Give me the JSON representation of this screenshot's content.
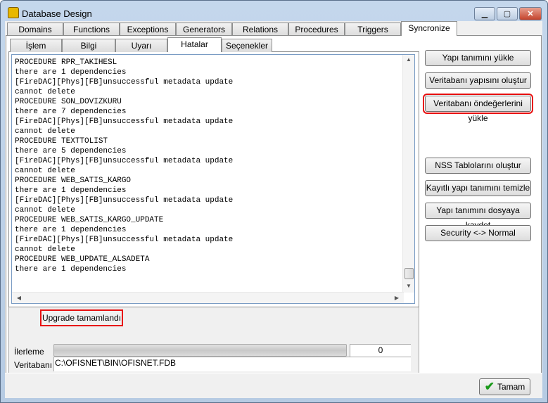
{
  "window": {
    "title": "Database Design",
    "controls": {
      "minimize": "▁",
      "maximize": "▢",
      "close": "✕"
    }
  },
  "main_tabs": [
    "Domains",
    "Functions",
    "Exceptions",
    "Generators",
    "Relations",
    "Procedures",
    "Triggers",
    "Syncronize"
  ],
  "main_tab_selected": "Syncronize",
  "sub_tabs": [
    "İşlem",
    "Bilgi",
    "Uyarı",
    "Hatalar",
    "Seçenekler"
  ],
  "sub_tab_selected": "Hatalar",
  "log_lines": [
    "PROCEDURE RPR_TAKIHESL",
    "there are 1 dependencies",
    "[FireDAC][Phys][FB]unsuccessful metadata update",
    "cannot delete",
    "PROCEDURE SON_DOVIZKURU",
    "there are 7 dependencies",
    "[FireDAC][Phys][FB]unsuccessful metadata update",
    "cannot delete",
    "PROCEDURE TEXTTOLIST",
    "there are 5 dependencies",
    "[FireDAC][Phys][FB]unsuccessful metadata update",
    "cannot delete",
    "PROCEDURE WEB_SATIS_KARGO",
    "there are 1 dependencies",
    "[FireDAC][Phys][FB]unsuccessful metadata update",
    "cannot delete",
    "PROCEDURE WEB_SATIS_KARGO_UPDATE",
    "there are 1 dependencies",
    "[FireDAC][Phys][FB]unsuccessful metadata update",
    "cannot delete",
    "PROCEDURE WEB_UPDATE_ALSADETA",
    "there are 1 dependencies"
  ],
  "buttons": [
    "Yapı tanımını yükle",
    "Veritabanı yapısını oluştur",
    "Veritabanı öndeğerlerini yükle",
    "NSS Tablolarını oluştur",
    "Kayıtlı yapı tanımını temizle",
    "Yapı tanımını dosyaya kaydet",
    "Security <-> Normal"
  ],
  "status": "Upgrade tamamlandı",
  "progress": {
    "label": "İlerleme",
    "value": "0",
    "percent": 0
  },
  "database": {
    "label": "Veritabanı",
    "path": "C:\\OFISNET\\BIN\\OFISNET.FDB"
  },
  "ok_button": "Tamam",
  "colors": {
    "highlight": "#e81010",
    "check": "#1a9a1a"
  }
}
